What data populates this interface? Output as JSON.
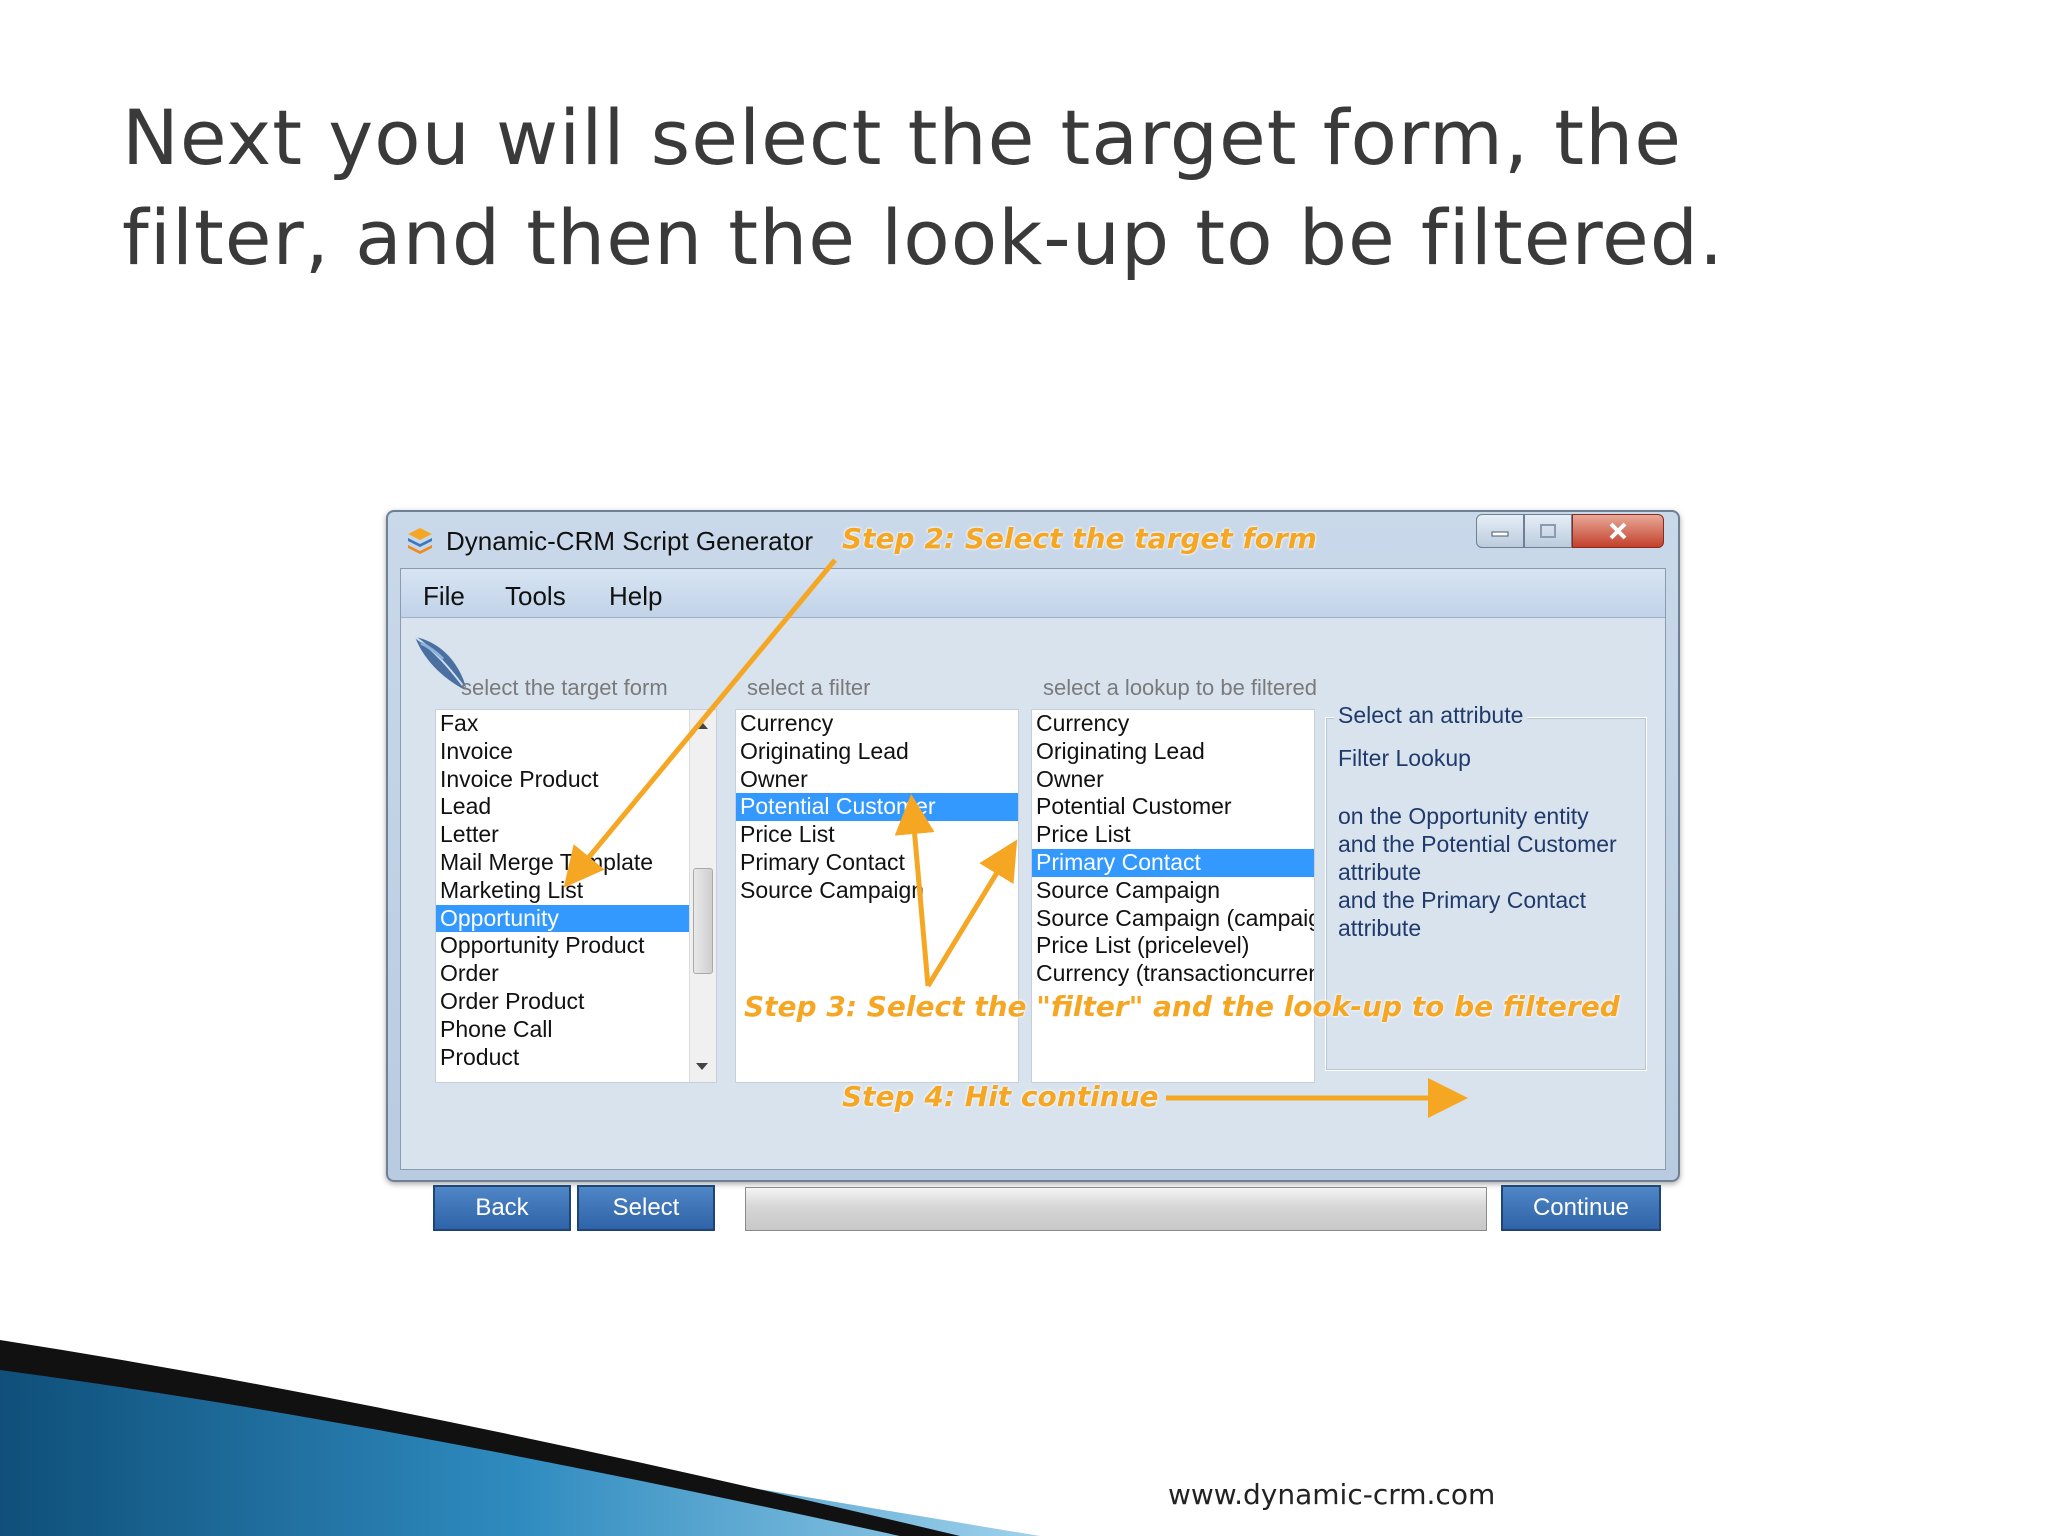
{
  "slide": {
    "title_line1": "Next you will select the target form, the",
    "title_line2": "filter, and then the look-up to be filtered.",
    "footer_url": "www.dynamic-crm.com"
  },
  "window": {
    "title": "Dynamic-CRM Script Generator",
    "icons": {
      "app": "stack-icon",
      "minimize": "minimize-icon",
      "maximize": "maximize-icon",
      "close": "close-icon",
      "logo": "feather-icon"
    }
  },
  "menu": {
    "file": "File",
    "tools": "Tools",
    "help": "Help"
  },
  "headers": {
    "target_form": "select the target form",
    "filter": "select a filter",
    "lookup": "select a lookup to be filtered"
  },
  "forms": [
    "Fax",
    "Invoice",
    "Invoice Product",
    "Lead",
    "Letter",
    "Mail Merge Template",
    "Marketing List",
    "Opportunity",
    "Opportunity Product",
    "Order",
    "Order Product",
    "Phone Call",
    "Product"
  ],
  "forms_selected": "Opportunity",
  "filters": [
    "Currency",
    "Originating Lead",
    "Owner",
    "Potential Customer",
    "Price List",
    "Primary Contact",
    "Source Campaign"
  ],
  "filters_selected": "Potential Customer",
  "lookups": [
    "Currency",
    "Originating Lead",
    "Owner",
    "Potential Customer",
    "Price List",
    "Primary Contact",
    "Source Campaign",
    "Source Campaign (campaign)",
    "Price List (pricelevel)",
    "Currency (transactioncurrency)"
  ],
  "lookups_selected": "Primary Contact",
  "info": {
    "legend": "Select an attribute",
    "action": "Filter Lookup",
    "line1": "on the Opportunity entity",
    "line2": "and the Potential Customer",
    "line3": "attribute",
    "line4": "and the Primary Contact",
    "line5": "attribute"
  },
  "buttons": {
    "back": "Back",
    "select": "Select",
    "continue": "Continue"
  },
  "annotations": {
    "step2": "Step 2: Select the target form",
    "step3": "Step 3: Select the \"filter\" and the look-up to be filtered",
    "step4": "Step 4: Hit continue"
  },
  "colors": {
    "annotation": "#f5a623",
    "selection": "#3399ff",
    "button": "#3a70b4",
    "info_text": "#203a6b"
  }
}
